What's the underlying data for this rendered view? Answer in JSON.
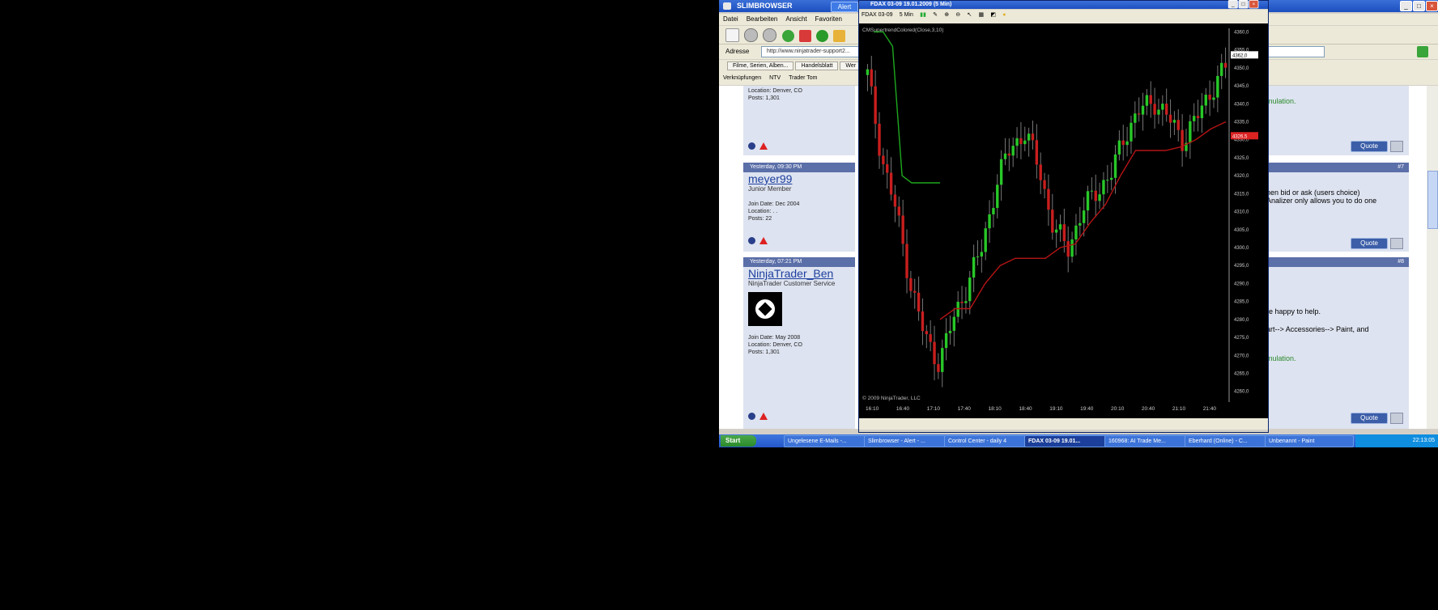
{
  "browser": {
    "title": "SLIMBROWSER",
    "alert": "Alert",
    "menu": [
      "Datei",
      "Bearbeiten",
      "Ansicht",
      "Favoriten"
    ],
    "address_label": "Adresse",
    "address_value": "http://www.ninjatrader-support2...",
    "tabs": [
      "Filme, Serien, Alben...",
      "Handelsblatt",
      "Wer"
    ],
    "links": [
      "Verknüpfungen",
      "NTV",
      "Trader Tom"
    ]
  },
  "posts": [
    {
      "location": "Location: Denver, CO",
      "posts": "Posts: 1,301"
    },
    {
      "header": "Yesterday, 09:30 PM",
      "username": "meyer99",
      "rank": "Junior Member",
      "join": "Join Date: Dec 2004",
      "location": "Location: . .",
      "posts": "Posts: 22"
    },
    {
      "header": "Yesterday, 07:21 PM",
      "username": "NinjaTrader_Ben",
      "rank": "NinjaTrader Customer Service",
      "join": "Join Date: May 2008",
      "location": "Location: Denver, CO",
      "posts": "Posts: 1,301"
    }
  ],
  "right_panels": [
    {
      "line1": "mulation.",
      "quote": "Quote"
    },
    {
      "number": "#7",
      "line1": "hen bid or ask (users choice)",
      "line2": "Analizer only allows you to do one",
      "quote": "Quote"
    },
    {
      "number": "#8",
      "line1": "re happy to help.",
      "line2": "art--> Accessories--> Paint, and",
      "line3": "mulation.",
      "quote": "Quote"
    }
  ],
  "chart_window": {
    "title": "FDAX 03-09 19.01.2009 (5 Min)",
    "instrument": "FDAX 03-09",
    "interval": "5 Min",
    "indicator": "CMSupertrendColored(Close,3,10)",
    "copyright": "© 2009 NinjaTrader, LLC",
    "price_marker": "4362,0",
    "stop_marker": "4326,5"
  },
  "chart_data": {
    "type": "candlestick",
    "x_ticks": [
      "16:10",
      "16:40",
      "17:10",
      "17:40",
      "18:10",
      "18:40",
      "19:10",
      "19:40",
      "20:10",
      "20:40",
      "21:10",
      "21:40"
    ],
    "y_ticks": [
      "4360,0",
      "4355,0",
      "4350,0",
      "4345,0",
      "4340,0",
      "4335,0",
      "4330,0",
      "4325,0",
      "4320,0",
      "4315,0",
      "4310,0",
      "4305,0",
      "4300,0",
      "4295,0",
      "4290,0",
      "4285,0",
      "4280,0",
      "4275,0",
      "4270,0",
      "4265,0",
      "4260,0"
    ],
    "ylim": [
      4257,
      4361
    ],
    "close_estimates": [
      4348,
      4325,
      4310,
      4290,
      4275,
      4268,
      4280,
      4290,
      4300,
      4318,
      4328,
      4332,
      4322,
      4305,
      4300,
      4310,
      4316,
      4320,
      4332,
      4338,
      4341,
      4336,
      4330,
      4336,
      4344,
      4350
    ],
    "supertrend_green": [
      4360,
      4360,
      4356,
      4320,
      4318,
      4318,
      4318,
      4318
    ],
    "supertrend_red": [
      4280,
      4283,
      4283,
      4290,
      4295,
      4297,
      4297,
      4297,
      4300,
      4301,
      4307,
      4312,
      4320,
      4327,
      4327,
      4327,
      4328,
      4330,
      4333,
      4335
    ],
    "colors": {
      "up": "#28c828",
      "down": "#c81e1e",
      "supertrend_up": "#1ea81e",
      "supertrend_down": "#b41414"
    }
  },
  "taskbar": {
    "start": "Start",
    "tasks": [
      "Ungelesene E-Mails -...",
      "Slimbrowser - Alert - ...",
      "Control Center - daily 4",
      "FDAX 03-09 19.01...",
      "160968: AI Trade Me...",
      "Eberhard (Online) - C...",
      "Unbenannt - Paint"
    ],
    "clock": "22:13:05"
  }
}
